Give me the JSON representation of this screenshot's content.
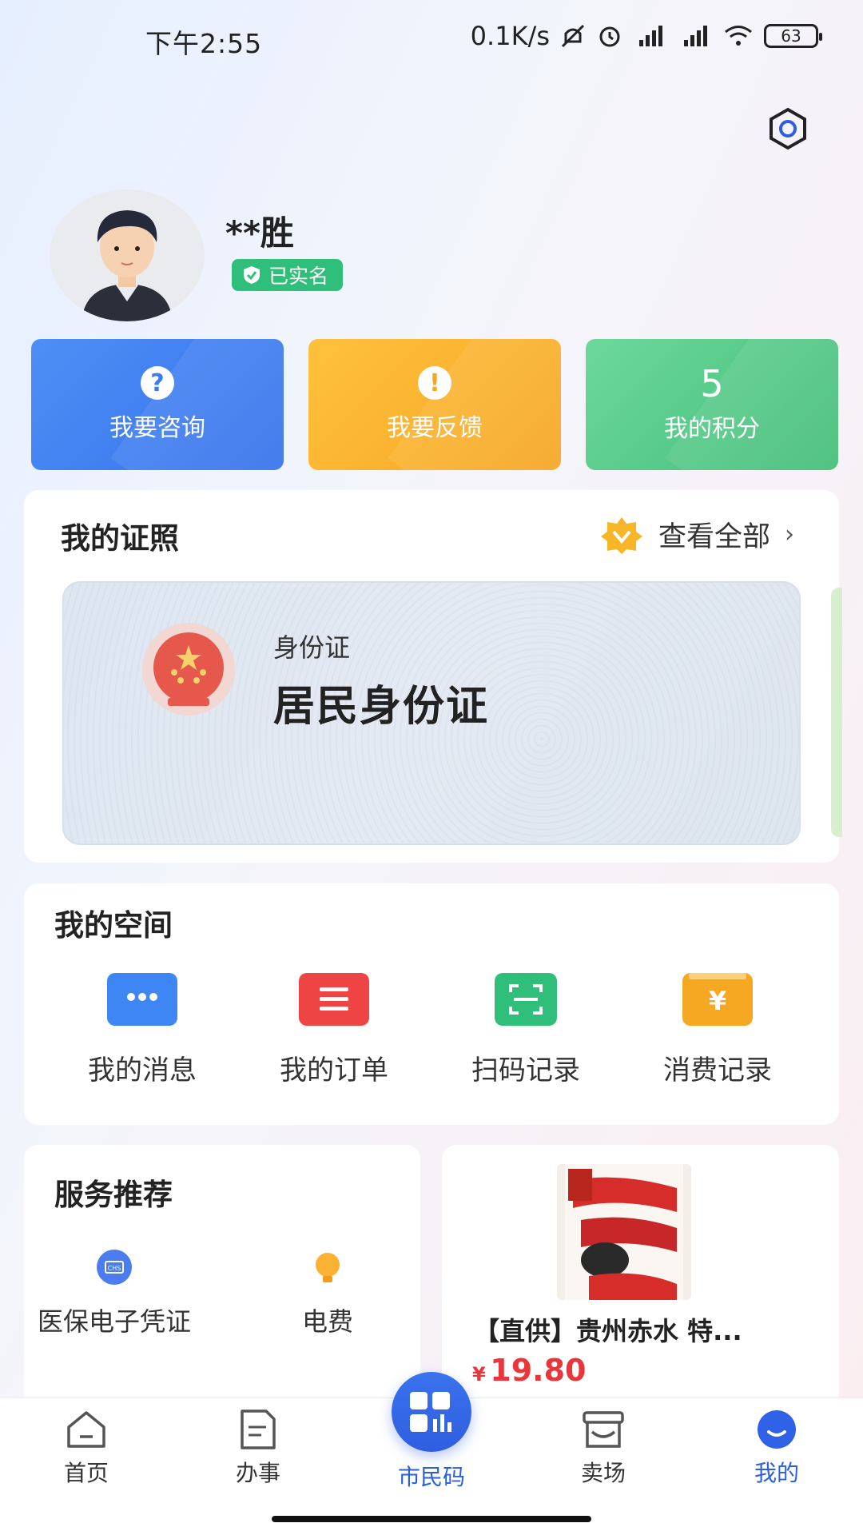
{
  "status_bar": {
    "time": "下午2:55",
    "net_speed": "0.1K/s",
    "battery": "63"
  },
  "profile": {
    "name": "**胜",
    "verified_label": "已实名"
  },
  "actions": {
    "consult": {
      "label": "我要咨询",
      "icon": "question-icon"
    },
    "feedback": {
      "label": "我要反馈",
      "icon": "exclamation-icon"
    },
    "points": {
      "value": "5",
      "label": "我的积分"
    }
  },
  "certificates": {
    "title": "我的证照",
    "view_all": "查看全部",
    "card": {
      "type": "身份证",
      "name": "居民身份证"
    }
  },
  "my_space": {
    "title": "我的空间",
    "items": [
      {
        "label": "我的消息",
        "icon": "message-icon",
        "color": "#3d86f4"
      },
      {
        "label": "我的订单",
        "icon": "order-list-icon",
        "color": "#ef4444"
      },
      {
        "label": "扫码记录",
        "icon": "scan-icon",
        "color": "#2fbf7a"
      },
      {
        "label": "消费记录",
        "icon": "wallet-yuan-icon",
        "color": "#f7a823"
      }
    ]
  },
  "services": {
    "title": "服务推荐",
    "items": [
      {
        "label": "医保电子凭证",
        "icon": "medical-insurance-icon"
      },
      {
        "label": "电费",
        "icon": "lightbulb-icon"
      }
    ]
  },
  "product": {
    "title": "【直供】贵州赤水 特...",
    "currency": "¥",
    "price": "19.80"
  },
  "bottom_nav": {
    "home": "首页",
    "affairs": "办事",
    "citizen_code": "市民码",
    "market": "卖场",
    "mine": "我的",
    "active": "我的"
  },
  "colors": {
    "primary": "#2f5ee0",
    "green": "#2fbf7a",
    "orange": "#f6a623",
    "price_red": "#e8363a"
  }
}
